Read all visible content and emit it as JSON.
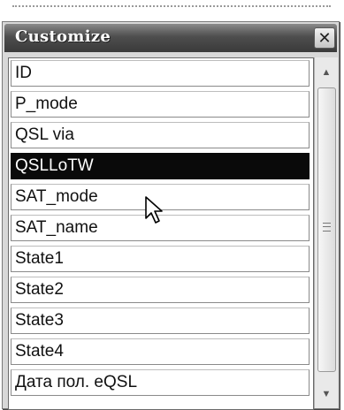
{
  "dialog": {
    "title": "Customize",
    "close_glyph": "✕"
  },
  "fields": [
    {
      "label": "ID"
    },
    {
      "label": "P_mode"
    },
    {
      "label": "QSL via"
    },
    {
      "label": "QSLLoTW",
      "selected": true
    },
    {
      "label": "SAT_mode"
    },
    {
      "label": "SAT_name"
    },
    {
      "label": "State1"
    },
    {
      "label": "State2"
    },
    {
      "label": "State3"
    },
    {
      "label": "State4"
    },
    {
      "label": "Дата пол. eQSL"
    }
  ],
  "scrollbar": {
    "up_glyph": "▲",
    "down_glyph": "▼"
  },
  "colors": {
    "selected_bg": "#0a0a0a",
    "selected_text": "#ffffff",
    "titlebar": "#3a3a3a"
  },
  "icons": {
    "cursor": "arrow-cursor-icon",
    "close": "close-icon",
    "grip": "scroll-grip-icon"
  }
}
